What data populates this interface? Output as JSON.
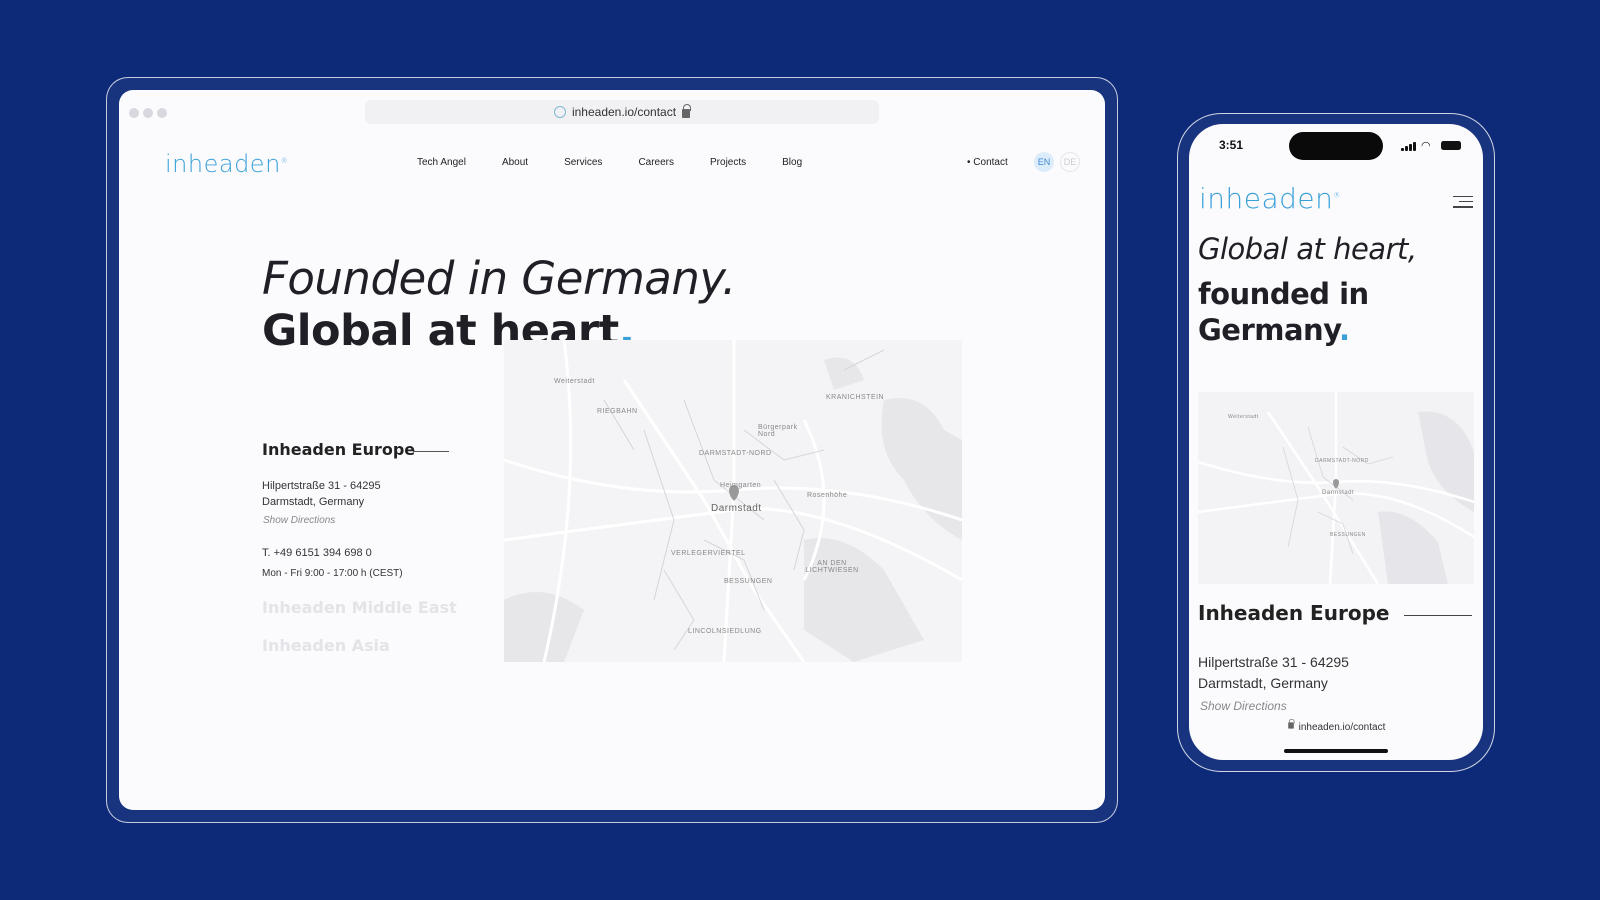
{
  "browser": {
    "url": "inheaden.io/contact",
    "logo": "inheaden",
    "nav": [
      "Tech Angel",
      "About",
      "Services",
      "Careers",
      "Projects",
      "Blog"
    ],
    "contact_link": "• Contact",
    "lang_en": "EN",
    "lang_de": "DE",
    "hero_line1": "Founded in Germany.",
    "hero_line2": "Global at heart",
    "hero_dot": ".",
    "office": {
      "title": "Inheaden Europe",
      "street": "Hilpertstraße 31 - 64295",
      "city": "Darmstadt, Germany",
      "directions": "Show Directions",
      "phone": "T. +49 6151 394 698 0",
      "hours": "Mon - Fri 9:00 - 17:00 h (CEST)"
    },
    "other_offices": [
      "Inheaden Middle East",
      "Inheaden Asia"
    ],
    "map_labels": [
      "Weiterstadt",
      "DARMSTADT-NORD",
      "Bürgerpark Nord",
      "Darmstadt",
      "Heimgarten",
      "Rosenhöhe",
      "VERLEGERVIERTEL",
      "BESSUNGEN",
      "AN DEN LICHTWIESEN",
      "KRANICHSTEIN",
      "RIEGBAHN",
      "LINCOLNSIEDLUNG"
    ]
  },
  "mobile": {
    "time": "3:51",
    "logo": "inheaden",
    "hero_line1": "Global at heart,",
    "hero_line2": "founded in Germany",
    "hero_dot": ".",
    "office_title": "Inheaden Europe",
    "street": "Hilpertstraße 31 - 64295",
    "city": "Darmstadt, Germany",
    "directions": "Show Directions",
    "url": "inheaden.io/contact",
    "map_labels": [
      "Weiterstadt",
      "DARMSTADT-NORD",
      "Darmstadt",
      "BESSUNGEN"
    ]
  },
  "colors": {
    "background": "#0d2a78",
    "accent": "#3aa0d8",
    "text": "#1f1f25"
  }
}
